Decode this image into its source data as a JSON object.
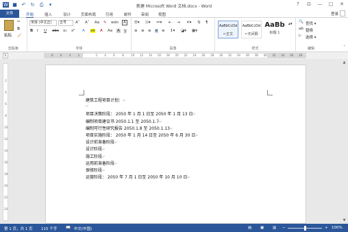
{
  "titlebar": {
    "title": "新建 Microsoft Word 文档.docx - Word",
    "icons": [
      "word-icon",
      "save-icon",
      "undo-icon",
      "redo-icon",
      "print-preview-icon",
      "customize-icon"
    ],
    "help": "?",
    "ribbon_opts": "⊡",
    "minimize": "—",
    "restore": "□",
    "close": "✕"
  },
  "tabs": [
    "文件",
    "开始",
    "插入",
    "设计",
    "页面布局",
    "引用",
    "邮件",
    "审阅",
    "视图"
  ],
  "active_tab": "开始",
  "login": "登录",
  "ribbon": {
    "paste": "粘贴",
    "clipboard_group": "剪贴板",
    "font_name": "宋体 (中文正)",
    "font_size": "五号",
    "grow_font": "A˄",
    "shrink_font": "A˅",
    "clear_format": "Aa",
    "wen": "wén",
    "char_border": "A",
    "bold": "B",
    "italic": "I",
    "underline": "U",
    "strike": "abc",
    "subscript": "x₂",
    "superscript": "x²",
    "font_color": "A",
    "highlight": "ab",
    "case": "Aa",
    "char_shading": "A",
    "enclose": "字",
    "font_group": "字体",
    "para_group": "段落",
    "styles": [
      {
        "preview": "AaBbCcDd",
        "name": "↵正文"
      },
      {
        "preview": "AaBbCcDd",
        "name": "↵无间隔"
      },
      {
        "preview": "AaBb",
        "name": "标题 1"
      }
    ],
    "style_group": "样式",
    "find": "查找 ▾",
    "replace": "替换",
    "select": "选择 ▾",
    "edit_group": "编辑"
  },
  "ruler_numbers": [
    "8",
    "6",
    "4",
    "2",
    "",
    "2",
    "4",
    "6",
    "8",
    "10",
    "12",
    "14",
    "16",
    "18",
    "20",
    "22",
    "24",
    "26",
    "28",
    "30",
    "32",
    "34",
    "36",
    "38",
    "40",
    "42",
    "44",
    "46",
    "48"
  ],
  "vruler_numbers": [
    "2",
    "4",
    "6",
    "8",
    "10",
    "12",
    "14",
    "16",
    "18",
    "20",
    "22",
    "24"
  ],
  "document": {
    "lines": [
      "建筑工程项目计划：",
      "",
      "项目决策阶段：    2050 年 1 月 1 日至 2050 年 1 月 13 日",
      "        编制项目建议书        2050.1.1 至 2050.1.7",
      "        编制可行性研究报告      2050.1.8 至 2050.1.13",
      "项目实施阶段：        2050 年 1 月 14 日至 2050 年 6 月 30 日",
      "        设计前准备阶段",
      "        设计阶段",
      "        施工阶段",
      "        运用前准备阶段",
      "        保修阶段",
      "运营阶段：          2050 年 7 月 1 日至 2050 年 10 月 10 日"
    ],
    "para_mark": "↵"
  },
  "status": {
    "page": "第 1 页，共 1 页",
    "words": "115 个字",
    "lang": "中文(中国)",
    "zoom": "100%",
    "zoom_fraction": 0.5
  },
  "colors": {
    "accent": "#2b579a"
  }
}
